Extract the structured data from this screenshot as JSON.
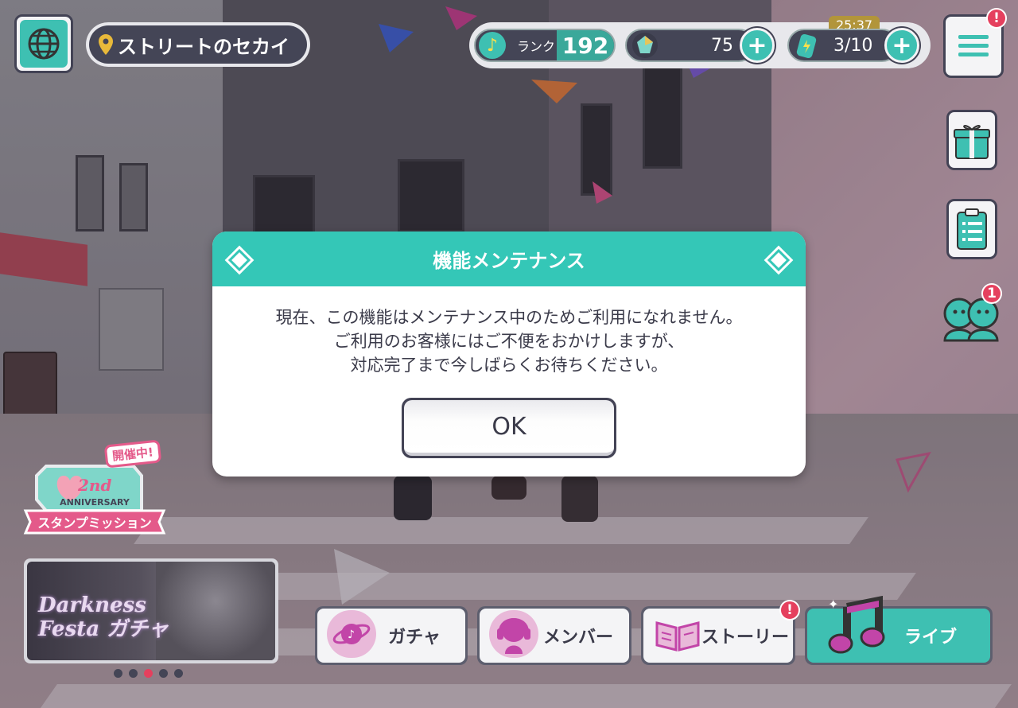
{
  "hud": {
    "location": "ストリートのセカイ",
    "rank_label": "ランク",
    "rank_value": "192",
    "crystals": "75",
    "stamina": "3/10",
    "stamina_timer": "25:37",
    "menu_badge": "!"
  },
  "side": {
    "friends_badge": "1"
  },
  "dialog": {
    "title": "機能メンテナンス",
    "line1": "現在、この機能はメンテナンス中のためご利用になれません。",
    "line2": "ご利用のお客様にはご不便をおかけしますが、",
    "line3": "対応完了まで今しばらくお待ちください。",
    "ok_label": "OK"
  },
  "event": {
    "badge": "開催中!",
    "line1": "2nd",
    "line2": "ANNIVERSARY",
    "line3": "スタンプミッション"
  },
  "banner": {
    "title_line1": "Darkness",
    "title_line2": "Festa ガチャ",
    "pages": 5,
    "active_page": 3
  },
  "nav": {
    "gacha": "ガチャ",
    "member": "メンバー",
    "story": "ストーリー",
    "story_badge": "!",
    "live": "ライブ"
  },
  "colors": {
    "accent": "#34c7b7",
    "dark": "#444556",
    "badge": "#e5405e"
  }
}
